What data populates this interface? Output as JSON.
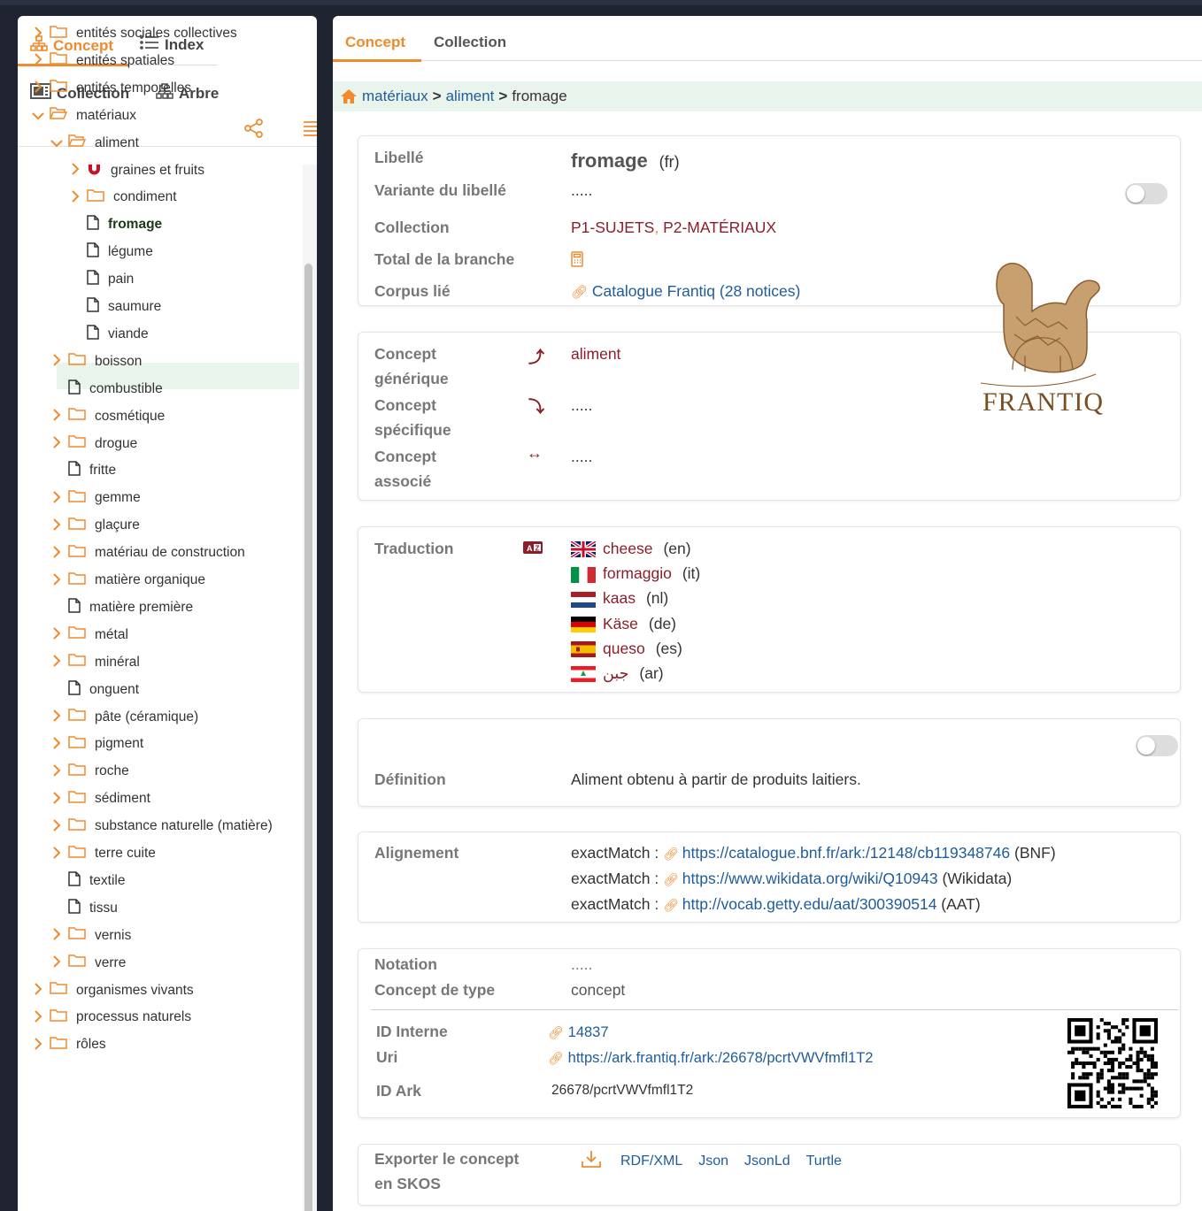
{
  "left": {
    "tabs": {
      "concept": "Concept",
      "index": "Index",
      "collection": "Collection",
      "arbre": "Arbre"
    },
    "tree": [
      {
        "label": "entités sociales collectives",
        "level": 0,
        "type": "folder",
        "expanded": false
      },
      {
        "label": "entités spatiales",
        "level": 0,
        "type": "folder",
        "expanded": false
      },
      {
        "label": "entités temporelles",
        "level": 0,
        "type": "folder",
        "expanded": false
      },
      {
        "label": "matériaux",
        "level": 0,
        "type": "folder",
        "expanded": true
      },
      {
        "label": "aliment",
        "level": 1,
        "type": "folder",
        "expanded": true
      },
      {
        "label": "graines et fruits",
        "level": 2,
        "type": "magnet",
        "expanded": false
      },
      {
        "label": "condiment",
        "level": 2,
        "type": "folder",
        "expanded": false
      },
      {
        "label": "fromage",
        "level": 2,
        "type": "file",
        "selected": true
      },
      {
        "label": "légume",
        "level": 2,
        "type": "file"
      },
      {
        "label": "pain",
        "level": 2,
        "type": "file"
      },
      {
        "label": "saumure",
        "level": 2,
        "type": "file"
      },
      {
        "label": "viande",
        "level": 2,
        "type": "file"
      },
      {
        "label": "boisson",
        "level": 1,
        "type": "folder",
        "expanded": false
      },
      {
        "label": "combustible",
        "level": 1,
        "type": "file"
      },
      {
        "label": "cosmétique",
        "level": 1,
        "type": "folder",
        "expanded": false
      },
      {
        "label": "drogue",
        "level": 1,
        "type": "folder",
        "expanded": false
      },
      {
        "label": "fritte",
        "level": 1,
        "type": "file"
      },
      {
        "label": "gemme",
        "level": 1,
        "type": "folder",
        "expanded": false
      },
      {
        "label": "glaçure",
        "level": 1,
        "type": "folder",
        "expanded": false
      },
      {
        "label": "matériau de construction",
        "level": 1,
        "type": "folder",
        "expanded": false
      },
      {
        "label": "matière organique",
        "level": 1,
        "type": "folder",
        "expanded": false
      },
      {
        "label": "matière première",
        "level": 1,
        "type": "file"
      },
      {
        "label": "métal",
        "level": 1,
        "type": "folder",
        "expanded": false
      },
      {
        "label": "minéral",
        "level": 1,
        "type": "folder",
        "expanded": false
      },
      {
        "label": "onguent",
        "level": 1,
        "type": "file"
      },
      {
        "label": "pâte (céramique)",
        "level": 1,
        "type": "folder",
        "expanded": false
      },
      {
        "label": "pigment",
        "level": 1,
        "type": "folder",
        "expanded": false
      },
      {
        "label": "roche",
        "level": 1,
        "type": "folder",
        "expanded": false
      },
      {
        "label": "sédiment",
        "level": 1,
        "type": "folder",
        "expanded": false
      },
      {
        "label": "substance naturelle (matière)",
        "level": 1,
        "type": "folder",
        "expanded": false
      },
      {
        "label": "terre cuite",
        "level": 1,
        "type": "folder",
        "expanded": false
      },
      {
        "label": "textile",
        "level": 1,
        "type": "file"
      },
      {
        "label": "tissu",
        "level": 1,
        "type": "file"
      },
      {
        "label": "vernis",
        "level": 1,
        "type": "folder",
        "expanded": false
      },
      {
        "label": "verre",
        "level": 1,
        "type": "folder",
        "expanded": false
      },
      {
        "label": "organismes vivants",
        "level": 0,
        "type": "folder",
        "expanded": false
      },
      {
        "label": "processus naturels",
        "level": 0,
        "type": "folder",
        "expanded": false
      },
      {
        "label": "rôles",
        "level": 0,
        "type": "folder",
        "expanded": false
      }
    ]
  },
  "right": {
    "tabs": {
      "concept": "Concept",
      "collection": "Collection"
    },
    "breadcrumb": {
      "item1": "matériaux",
      "item2": "aliment",
      "current": "fromage",
      "sep": ">"
    },
    "card1": {
      "libelle_label": "Libellé",
      "libelle_value": "fromage",
      "libelle_lang": "(fr)",
      "variante_label": "Variante du libellé",
      "variante_value": ".....",
      "collection_label": "Collection",
      "collection_1": "P1-SUJETS",
      "collection_sep": ",",
      "collection_2": "P2-MATÉRIAUX",
      "total_label": "Total de la branche",
      "corpus_label": "Corpus lié",
      "corpus_value": "Catalogue Frantiq (28 notices)"
    },
    "logo_text": "FRANTIQ",
    "card2": {
      "generique_label_1": "Concept",
      "generique_label_2": "générique",
      "generique_value": "aliment",
      "specifique_label_1": "Concept",
      "specifique_label_2": "spécifique",
      "specifique_value": ".....",
      "associe_label_1": "Concept",
      "associe_label_2": "associé",
      "associe_value": "....."
    },
    "card3": {
      "label": "Traduction",
      "translations": [
        {
          "term": "cheese",
          "lang": "(en)",
          "flag": "uk-flag"
        },
        {
          "term": "formaggio",
          "lang": "(it)",
          "flag": "italy-flag"
        },
        {
          "term": "kaas",
          "lang": "(nl)",
          "flag": "netherlands-flag"
        },
        {
          "term": "Käse",
          "lang": "(de)",
          "flag": "germany-flag"
        },
        {
          "term": "queso",
          "lang": "(es)",
          "flag": "spain-flag"
        },
        {
          "term": "جبن",
          "lang": "(ar)",
          "flag": "lebanon-flag"
        }
      ]
    },
    "card4": {
      "label": "Définition",
      "value": "Aliment obtenu à partir de produits laitiers."
    },
    "card5": {
      "label": "Alignement",
      "matches": [
        {
          "prefix": "exactMatch :",
          "url": "https://catalogue.bnf.fr/ark:/12148/cb119348746",
          "source": "(BNF)"
        },
        {
          "prefix": "exactMatch :",
          "url": "https://www.wikidata.org/wiki/Q10943",
          "source": "(Wikidata)"
        },
        {
          "prefix": "exactMatch :",
          "url": "http://vocab.getty.edu/aat/300390514",
          "source": "(AAT)"
        }
      ]
    },
    "card6": {
      "notation_label": "Notation",
      "notation_value": ".....",
      "type_label": "Concept de type",
      "type_value": "concept",
      "id_label": "ID Interne",
      "id_value": "14837",
      "uri_label": "Uri",
      "uri_value": "https://ark.frantiq.fr/ark:/26678/pcrtVWVfmfl1T2",
      "ark_label": "ID Ark",
      "ark_value": "26678/pcrtVWVfmfl1T2"
    },
    "card7": {
      "label_1": "Exporter le concept",
      "label_2": "en SKOS",
      "formats": [
        "RDF/XML",
        "Json",
        "JsonLd",
        "Turtle"
      ]
    }
  },
  "colors": {
    "accent": "#f08a2c",
    "link": "#1f5c99",
    "maroon": "#8b1e2a",
    "selected_bg": "#e9f5ec"
  }
}
